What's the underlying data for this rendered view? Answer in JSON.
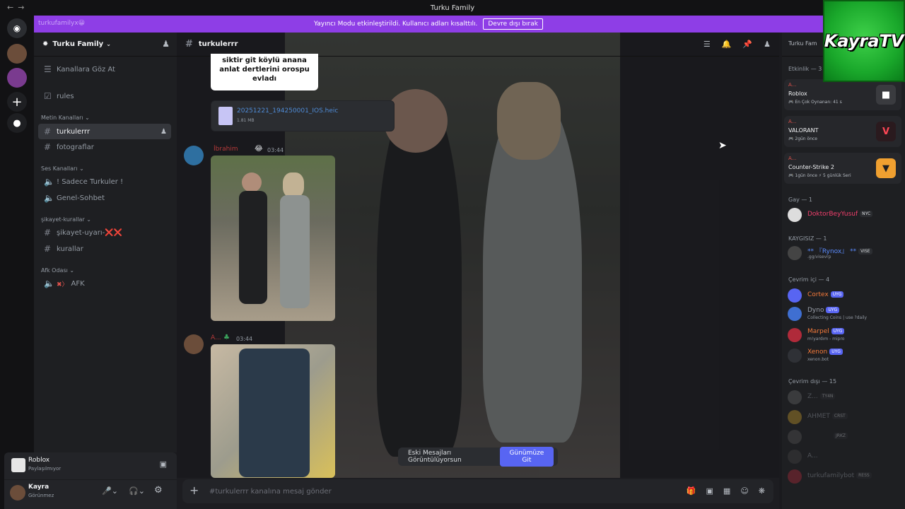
{
  "titlebar": {
    "title": "Turku Family"
  },
  "banner": {
    "ghost_text": "turkufamilyx😀",
    "message": "Yayıncı Modu etkinleştirildi. Kullanıcı adları kısalttılı.",
    "button": "Devre dışı bırak"
  },
  "server": {
    "name": "Turku Family"
  },
  "sidebar": {
    "top_items": [
      {
        "label": "Kanallara Göz At",
        "icon": "list-icon"
      },
      {
        "label": "rules",
        "icon": "checkbox-icon"
      }
    ],
    "categories": [
      {
        "name": "Metin Kanalları",
        "channels": [
          {
            "label": "turkulerrr",
            "type": "text",
            "active": true
          },
          {
            "label": "fotograflar",
            "type": "text",
            "active": false
          }
        ]
      },
      {
        "name": "Ses Kanalları",
        "channels": [
          {
            "label": "! Sadece Turkuler !",
            "type": "voice"
          },
          {
            "label": "Genel-Sohbet",
            "type": "voice"
          }
        ]
      },
      {
        "name": "şikayet-kurallar",
        "channels": [
          {
            "label": "şikayet-uyarı-❌❌",
            "type": "text"
          },
          {
            "label": "kurallar",
            "type": "text"
          }
        ]
      },
      {
        "name": "Afk Odası",
        "channels": [
          {
            "label": "AFK",
            "type": "voice"
          }
        ]
      }
    ]
  },
  "activity_panel": {
    "game": "Roblox",
    "status": "Paylaşılmıyor"
  },
  "user": {
    "name": "Kayra",
    "status": "Görünmez"
  },
  "chat": {
    "channel": "turkulerrr",
    "meme_text": "siktir git köylü anana anlat dertlerini orospu evladı",
    "file": {
      "name": "20251221_194250001_IOS.heic",
      "size": "1.81 MB"
    },
    "messages": [
      {
        "author": "İbrahim",
        "time": "03:44"
      },
      {
        "author": "A...",
        "time": "03:44"
      }
    ],
    "toast_text": "Eski Mesajları Görüntülüyorsun",
    "toast_button": "Günümüze Git",
    "composer_placeholder": "#turkulerrr kanalına mesaj gönder"
  },
  "members": {
    "header_partial": "Turku Fam",
    "activity_title": "Etkinlik — 3",
    "activities": [
      {
        "who": "A...",
        "game": "Roblox",
        "detail": "🎮 En Çok Oynanan: 41 s",
        "color": "#ffffff"
      },
      {
        "who": "A...",
        "game": "VALORANT",
        "detail": "🎮 2gün önce",
        "color": "#ff4655"
      },
      {
        "who": "A...",
        "game": "Counter-Strike 2",
        "detail": "🎮 1gün önce  ⚡ 5 günlük Seri",
        "color": "#f0a030"
      }
    ],
    "groups": [
      {
        "title": "Gay — 1",
        "items": [
          {
            "name": "DoktorBeyYusuf",
            "tag": "NYC",
            "color": "#f23f6c",
            "status": ""
          }
        ]
      },
      {
        "title": "KAYGISIZ — 1",
        "items": [
          {
            "name": "** 『Rynox』 **",
            "tag": "VISE",
            "color": "#5b8cff",
            "status": ".gg/visevrp"
          }
        ]
      },
      {
        "title": "Çevrim içi — 4",
        "items": [
          {
            "name": "Cortex",
            "tag": "UYG",
            "color": "#f57a3a",
            "status": ""
          },
          {
            "name": "Dyno",
            "tag": "UYG",
            "color": "#9aa0aa",
            "status": "Collecting Coins | use ?daily"
          },
          {
            "name": "Marpel",
            "tag": "UYG",
            "color": "#f57a3a",
            "status": "m!yardım - mipro"
          },
          {
            "name": "Xenon",
            "tag": "UYG",
            "color": "#f57a3a",
            "status": "xenon.bot"
          }
        ]
      },
      {
        "title": "Çevrim dışı — 15",
        "items": [
          {
            "name": "Z...",
            "tag": "TY4N",
            "color": "#6b6f76",
            "status": ""
          },
          {
            "name": "AHMET",
            "tag": "CRST",
            "color": "#6b6f76",
            "status": ""
          },
          {
            "name": "",
            "tag": "JRKZ",
            "color": "#6b6f76",
            "status": ""
          },
          {
            "name": "A...",
            "tag": "",
            "color": "#6b6f76",
            "status": ""
          },
          {
            "name": "turkufamilybot",
            "tag": "RESS",
            "color": "#6b6f76",
            "status": ""
          }
        ]
      }
    ]
  },
  "logo": {
    "text": "KayraTV"
  },
  "colors": {
    "accent": "#5865f2",
    "banner": "#8e3ee6",
    "online": "#23a55a"
  }
}
